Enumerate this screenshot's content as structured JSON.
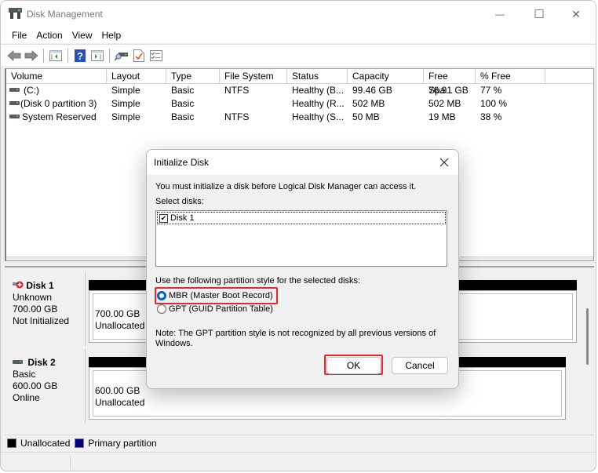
{
  "window": {
    "title": "Disk Management",
    "controls": {
      "minimize": "—",
      "maximize": "☐",
      "close": "✕"
    }
  },
  "menu": [
    "File",
    "Action",
    "View",
    "Help"
  ],
  "toolbar": {
    "buttons": [
      "back-icon",
      "forward-icon",
      "show-hide-console-tree-icon",
      "help-icon",
      "show-hide-action-pane-icon",
      "rescan-disks-icon",
      "properties-icon",
      "settings-list-icon"
    ]
  },
  "volumes": {
    "columns": [
      "Volume",
      "Layout",
      "Type",
      "File System",
      "Status",
      "Capacity",
      "Free Spa...",
      "% Free"
    ],
    "rows": [
      {
        "volume": "(C:)",
        "layout": "Simple",
        "type": "Basic",
        "fs": "NTFS",
        "status": "Healthy (B...",
        "capacity": "99.46 GB",
        "free": "76.91 GB",
        "pct": "77 %"
      },
      {
        "volume": "(Disk 0 partition 3)",
        "layout": "Simple",
        "type": "Basic",
        "fs": "",
        "status": "Healthy (R...",
        "capacity": "502 MB",
        "free": "502 MB",
        "pct": "100 %"
      },
      {
        "volume": "System Reserved",
        "layout": "Simple",
        "type": "Basic",
        "fs": "NTFS",
        "status": "Healthy (S...",
        "capacity": "50 MB",
        "free": "19 MB",
        "pct": "38 %"
      }
    ]
  },
  "disks": [
    {
      "name": "Disk 1",
      "type": "Unknown",
      "size": "700.00 GB",
      "state": "Not Initialized",
      "partition_size": "700.00 GB",
      "partition_label": "Unallocated"
    },
    {
      "name": "Disk 2",
      "type": "Basic",
      "size": "600.00 GB",
      "state": "Online",
      "partition_size": "600.00 GB",
      "partition_label": "Unallocated"
    }
  ],
  "legend": [
    {
      "label": "Unallocated",
      "color": "#000000"
    },
    {
      "label": "Primary partition",
      "color": "#000080"
    }
  ],
  "dialog": {
    "title": "Initialize Disk",
    "message": "You must initialize a disk before Logical Disk Manager can access it.",
    "select_label": "Select disks:",
    "disk_items": [
      {
        "label": "Disk 1",
        "checked": true
      }
    ],
    "style_label": "Use the following partition style for the selected disks:",
    "options": [
      {
        "label": "MBR (Master Boot Record)",
        "selected": true
      },
      {
        "label": "GPT (GUID Partition Table)",
        "selected": false
      }
    ],
    "note_line1": "Note: The GPT partition style is not recognized by all previous versions of",
    "note_line2": "Windows.",
    "ok": "OK",
    "cancel": "Cancel",
    "highlight_color": "#e8262b"
  }
}
